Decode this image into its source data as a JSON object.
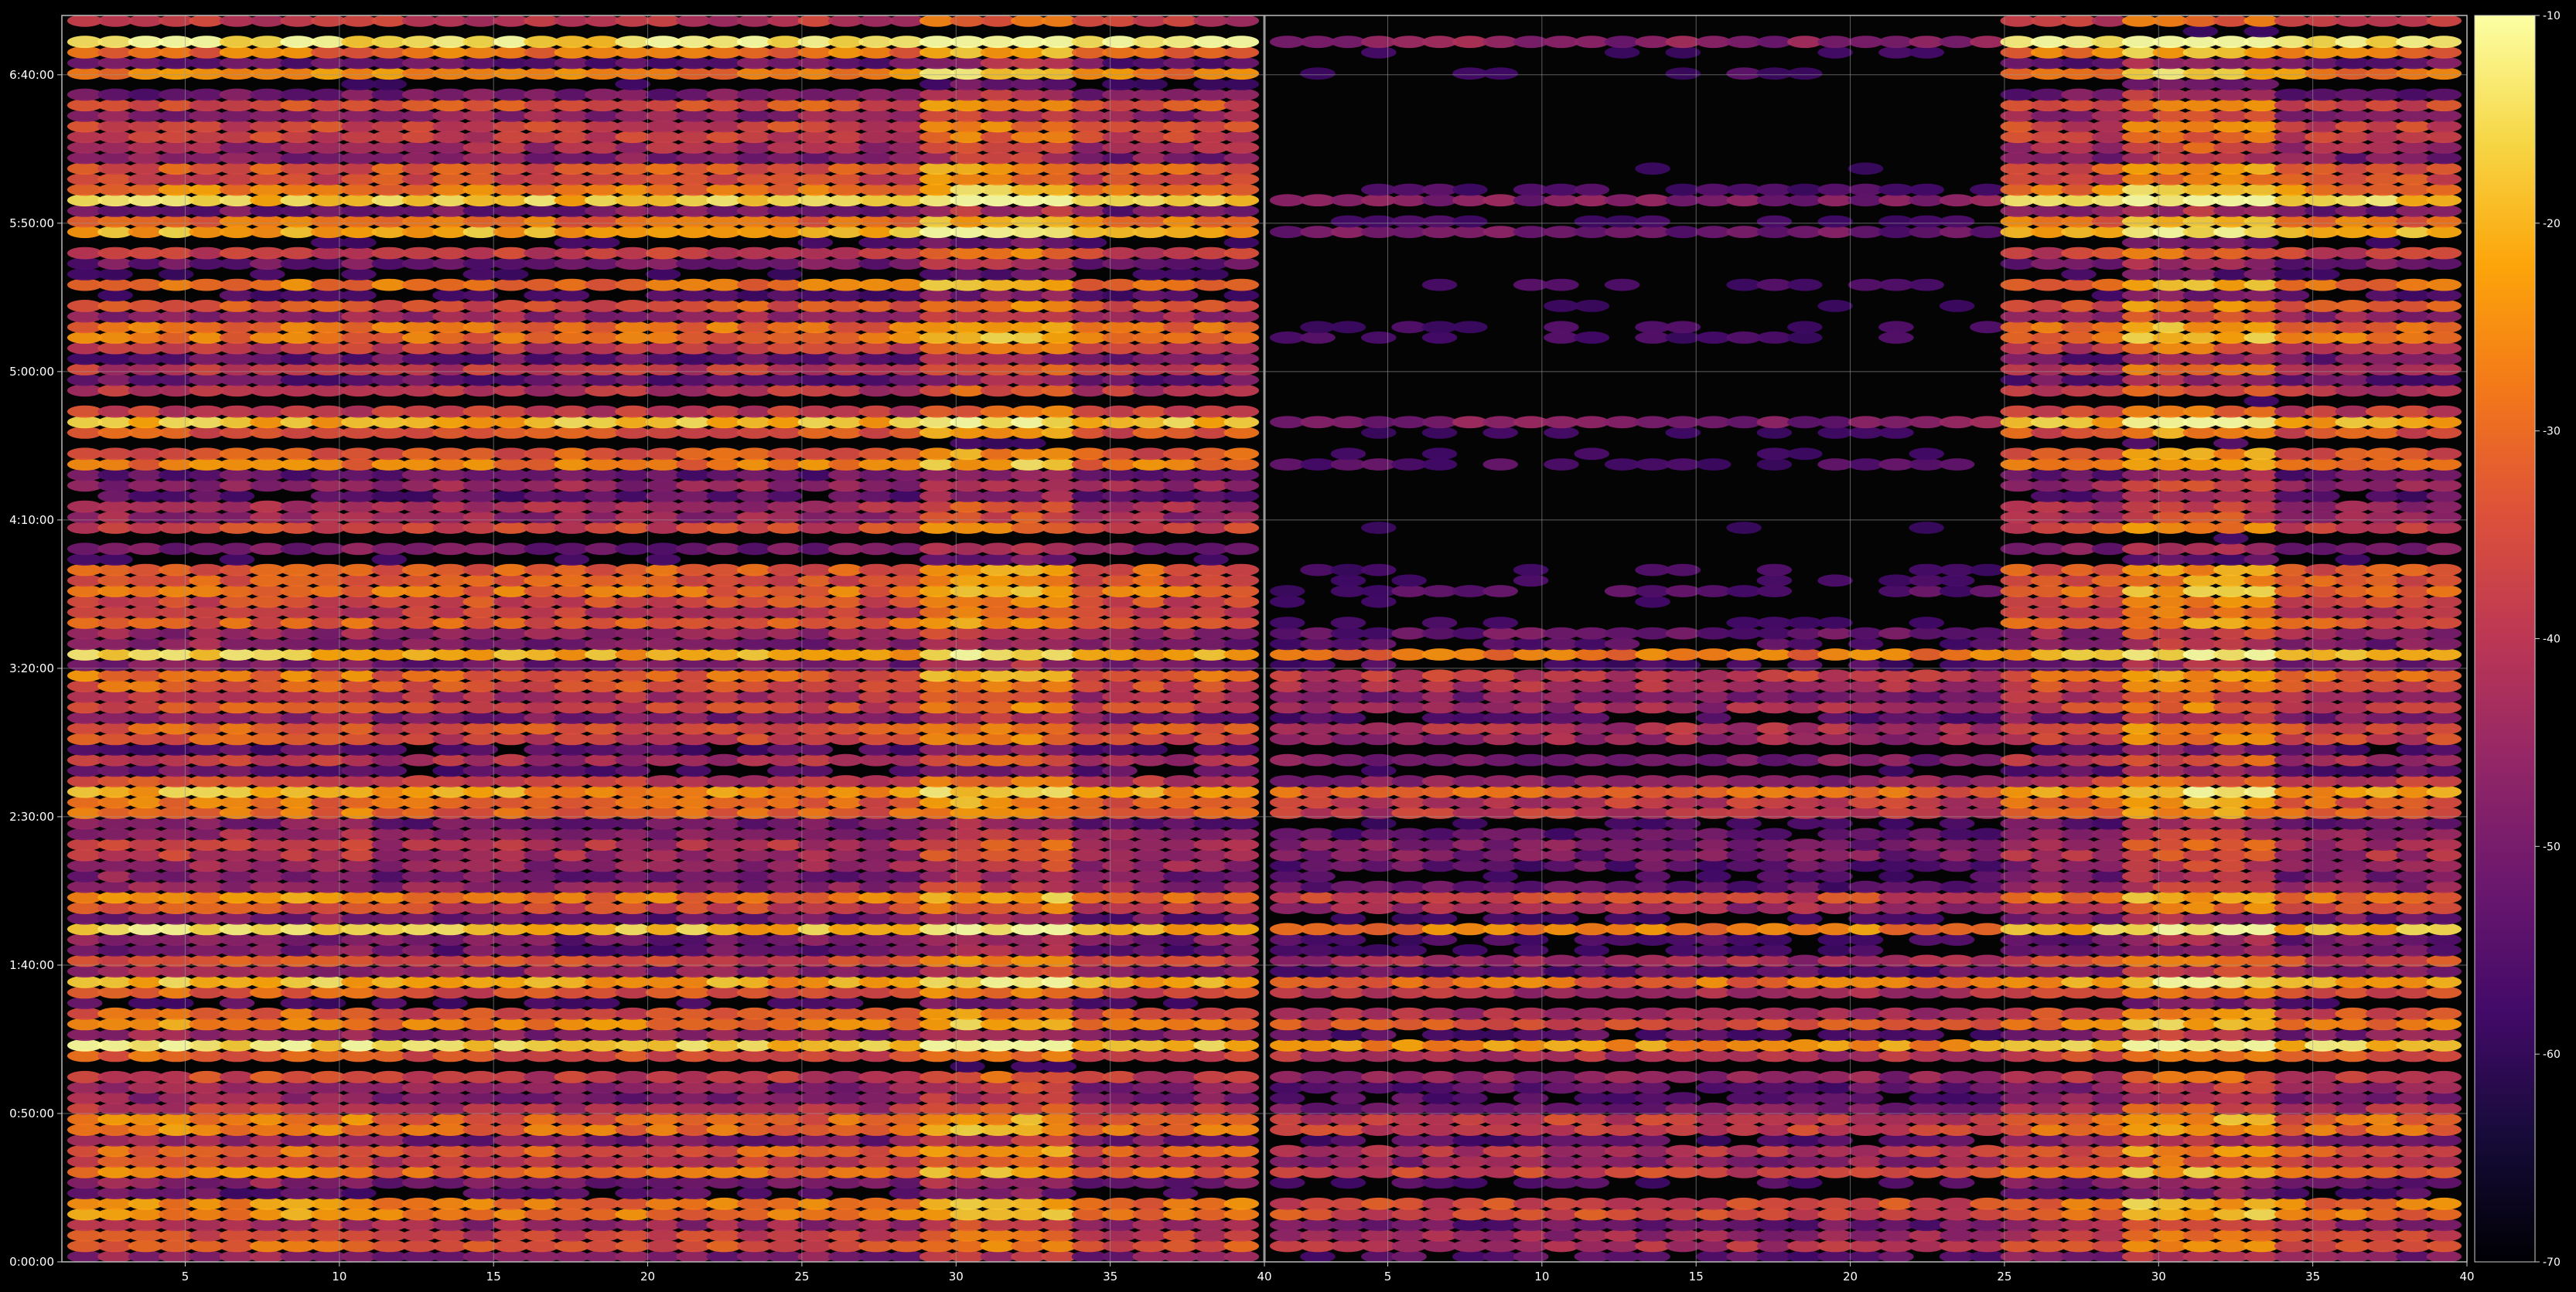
{
  "chart_data": {
    "type": "heatmap",
    "colormap": "inferno",
    "background": "#000000",
    "grid": true,
    "grid_color": "#9a9a9a",
    "x_tick_labels": [
      "5",
      "10",
      "15",
      "20",
      "25",
      "30",
      "35",
      "40",
      "5",
      "10",
      "15",
      "20",
      "25",
      "30",
      "35",
      "40"
    ],
    "y_tick_labels": [
      "0:00:00",
      "0:50:00",
      "1:40:00",
      "2:30:00",
      "3:20:00",
      "4:10:00",
      "5:00:00",
      "5:50:00",
      "6:40:00"
    ],
    "panels": [
      {
        "x_range": [
          1,
          40
        ],
        "x_ticks": [
          5,
          10,
          15,
          20,
          25,
          30,
          35,
          40
        ],
        "y_range_seconds": [
          0,
          25200
        ],
        "columns": 39,
        "description_of_values": "signal level per channel (x) over elapsed time (y); warmest band near channels 29-33"
      },
      {
        "x_range": [
          1,
          40
        ],
        "x_ticks": [
          5,
          10,
          15,
          20,
          25,
          30,
          35,
          40
        ],
        "y_range_seconds": [
          0,
          25200
        ],
        "columns": 39
      }
    ],
    "colorbar": {
      "range": [
        -70,
        -10
      ],
      "ticks": [
        -10,
        -20,
        -30,
        -40,
        -50,
        -60,
        -70
      ],
      "tick_labels": [
        "-10",
        "-20",
        "-30",
        "-40",
        "-50",
        "-60",
        "-70"
      ],
      "scale_top_color": "#fcffa4",
      "scale_bottom_color": "#000004"
    }
  }
}
